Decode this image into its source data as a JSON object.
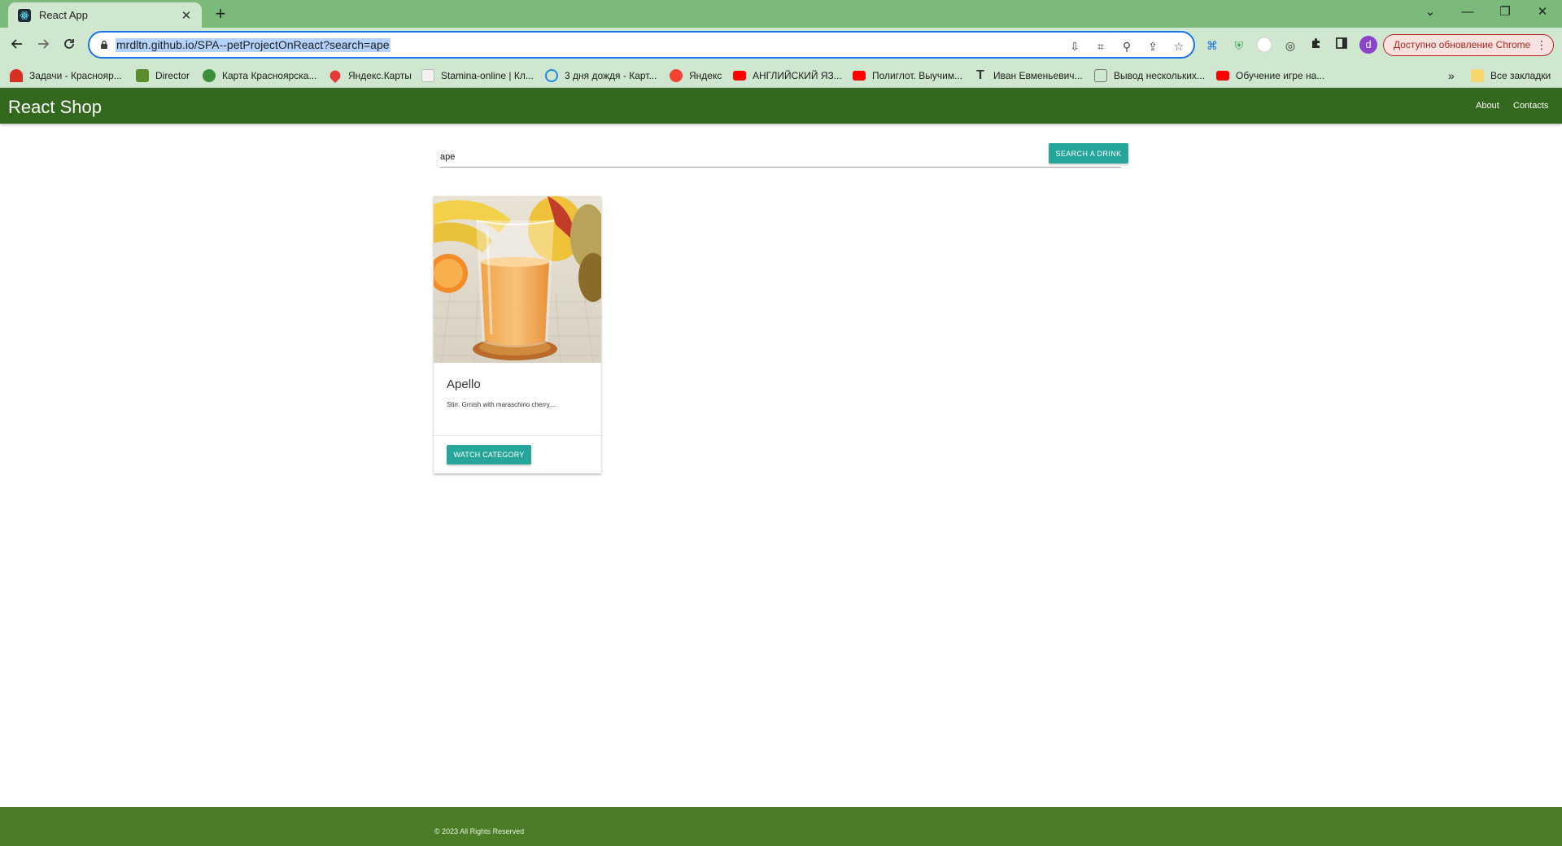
{
  "browser": {
    "tab": {
      "title": "React App",
      "close": "✕"
    },
    "new_tab": "+",
    "window_controls": {
      "minimize": "—",
      "restore": "❐",
      "close": "✕",
      "tabs_list": "⌄"
    },
    "url": "mrdltn.github.io/SPA--petProjectOnReact?search=ape",
    "avatar_letter": "d",
    "update_button": "Доступно обновление Chrome",
    "bookmarks": [
      {
        "label": "Задачи - Краснояр...",
        "icon": "red-arc-icon",
        "color": "#d93025"
      },
      {
        "label": "Director",
        "icon": "puzzle-icon",
        "color": "#5b8c2a"
      },
      {
        "label": "Карта Красноярска...",
        "icon": "globe-icon",
        "color": "#3b8f3b"
      },
      {
        "label": "Яндекс.Карты",
        "icon": "map-pin-icon",
        "color": "#e53935"
      },
      {
        "label": "Stamina-online | Кл...",
        "icon": "page-icon",
        "color": "#e0e0e0"
      },
      {
        "label": "3 дня дождя - Карт...",
        "icon": "circle-icon",
        "color": "#1e88e5"
      },
      {
        "label": "Яндекс",
        "icon": "yandex-icon",
        "color": "#f44336"
      },
      {
        "label": "АНГЛИЙСКИЙ ЯЗ...",
        "icon": "youtube-icon",
        "color": "#ff0000"
      },
      {
        "label": "Полиглот. Выучим...",
        "icon": "youtube-icon",
        "color": "#ff0000"
      },
      {
        "label": "Иван Евменьевич...",
        "icon": "t-letter-icon",
        "color": "#333333"
      },
      {
        "label": "Вывод нескольких...",
        "icon": "page-icon",
        "color": "#9aa0a6"
      },
      {
        "label": "Обучение игре на...",
        "icon": "youtube-icon",
        "color": "#ff0000"
      }
    ],
    "bookmarks_more": "»",
    "all_bookmarks": "Все закладки"
  },
  "app": {
    "brand": "React Shop",
    "nav": {
      "about": "About",
      "contacts": "Contacts"
    },
    "search": {
      "value": "ape",
      "button": "SEARCH A DRINK"
    },
    "cards": [
      {
        "title": "Apello",
        "description": "Stirr. Grnish with maraschino cherry....",
        "button": "WATCH CATEGORY"
      }
    ],
    "footer": "© 2023 All Rights Reserved"
  }
}
